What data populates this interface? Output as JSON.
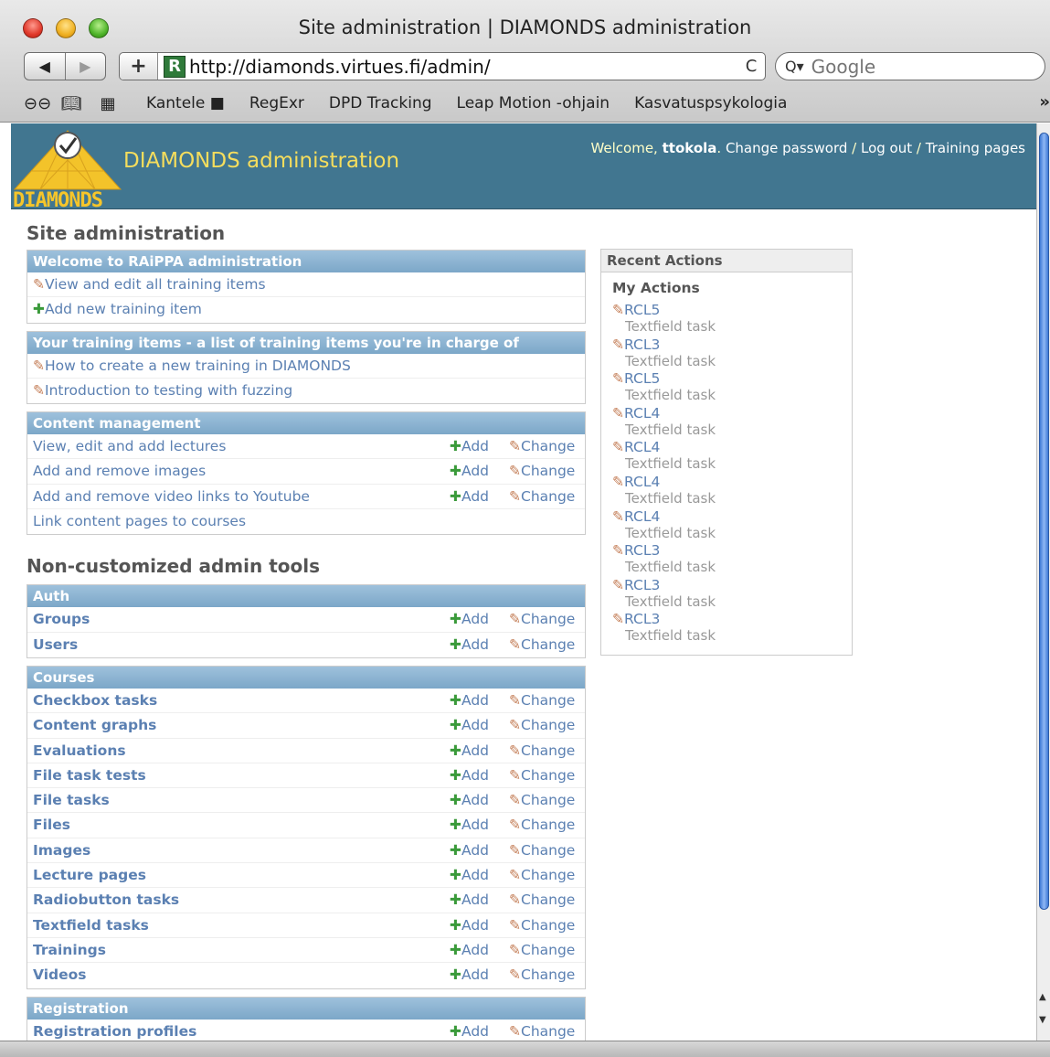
{
  "window": {
    "title": "Site administration | DIAMONDS administration"
  },
  "nav": {
    "back": "◀",
    "forward": "▶"
  },
  "address": {
    "plus": "+",
    "favicon": "R",
    "url": "http://diamonds.virtues.fi/admin/",
    "reload": "C"
  },
  "search": {
    "placeholder": "Google",
    "icon": "Q▾"
  },
  "bookmarks": {
    "icons": [
      "reader-icon",
      "book-icon",
      "grid-icon"
    ],
    "items": [
      "Kantele ■",
      "RegExr",
      "DPD Tracking",
      "Leap Motion -ohjain",
      "Kasvatuspsykologia"
    ],
    "more": "»"
  },
  "header": {
    "logo_text": "DIAMONDS",
    "site_name": "DIAMONDS administration",
    "welcome": "Welcome,",
    "username": "ttokola",
    "change_password": "Change password",
    "sep": "/",
    "logout": "Log out",
    "training": "Training pages"
  },
  "main": {
    "title": "Site administration",
    "welcome_module": {
      "caption": "Welcome to RAiPPA administration",
      "items": [
        "View and edit all training items",
        "Add new training item"
      ]
    },
    "training_module": {
      "caption": "Your training items - a list of training items you're in charge of",
      "items": [
        "How to create a new training in DIAMONDS",
        "Introduction to testing with fuzzing"
      ]
    },
    "content_module": {
      "caption": "Content management",
      "rows": [
        "View, edit and add lectures",
        "Add and remove images",
        "Add and remove video links to Youtube",
        "Link content pages to courses"
      ]
    },
    "non_custom_title": "Non-customized admin tools",
    "auth": {
      "caption": "Auth",
      "rows": [
        "Groups",
        "Users"
      ]
    },
    "courses": {
      "caption": "Courses",
      "rows": [
        "Checkbox tasks",
        "Content graphs",
        "Evaluations",
        "File task tests",
        "File tasks",
        "Files",
        "Images",
        "Lecture pages",
        "Radiobutton tasks",
        "Textfield tasks",
        "Trainings",
        "Videos"
      ]
    },
    "registration": {
      "caption": "Registration",
      "rows": [
        "Registration profiles"
      ]
    },
    "add_label": "Add",
    "change_label": "Change"
  },
  "recent": {
    "caption": "Recent Actions",
    "subtitle": "My Actions",
    "items": [
      {
        "name": "RCL5",
        "type": "Textfield task"
      },
      {
        "name": "RCL3",
        "type": "Textfield task"
      },
      {
        "name": "RCL5",
        "type": "Textfield task"
      },
      {
        "name": "RCL4",
        "type": "Textfield task"
      },
      {
        "name": "RCL4",
        "type": "Textfield task"
      },
      {
        "name": "RCL4",
        "type": "Textfield task"
      },
      {
        "name": "RCL4",
        "type": "Textfield task"
      },
      {
        "name": "RCL3",
        "type": "Textfield task"
      },
      {
        "name": "RCL3",
        "type": "Textfield task"
      },
      {
        "name": "RCL3",
        "type": "Textfield task"
      }
    ]
  },
  "colors": {
    "header_bg": "#417690",
    "caption_bg": "#7ca7c8",
    "link": "#5b80b2",
    "brand_yellow": "#f5dd5d"
  }
}
